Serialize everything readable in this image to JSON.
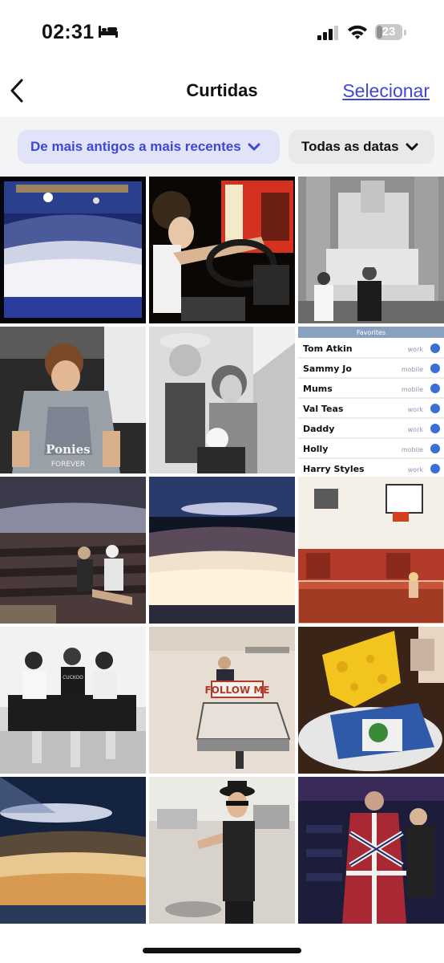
{
  "status": {
    "time": "02:31",
    "battery": "23",
    "battery_level": 0.23
  },
  "nav": {
    "title": "Curtidas",
    "select_label": "Selecionar"
  },
  "filters": {
    "sort_label": "De mais antigos a mais recentes",
    "date_label": "Todas as datas"
  },
  "tiles": [
    {
      "name": "photo-concert-arena"
    },
    {
      "name": "photo-driving-bus"
    },
    {
      "name": "photo-lincoln-memorial"
    },
    {
      "name": "photo-ponies-tshirt"
    },
    {
      "name": "photo-hug-stairs"
    },
    {
      "name": "photo-contacts-screen"
    },
    {
      "name": "photo-stadium-seats"
    },
    {
      "name": "photo-concert-crowd"
    },
    {
      "name": "photo-basketball-court"
    },
    {
      "name": "photo-three-on-sofa"
    },
    {
      "name": "photo-follow-me-sign"
    },
    {
      "name": "photo-cheese-hat"
    },
    {
      "name": "photo-concert-lights"
    },
    {
      "name": "photo-hat-pointing"
    },
    {
      "name": "photo-flag-jacket"
    }
  ],
  "contacts": {
    "header": "Favorites",
    "rows": [
      {
        "name": "Tom Atkin",
        "type": "work"
      },
      {
        "name": "Sammy Jo",
        "type": "mobile"
      },
      {
        "name": "Mums",
        "type": "mobile"
      },
      {
        "name": "Val Teas",
        "type": "work"
      },
      {
        "name": "Daddy",
        "type": "work"
      },
      {
        "name": "Holly",
        "type": "mobile"
      },
      {
        "name": "Harry Styles",
        "type": "work"
      }
    ]
  },
  "sign_texts": {
    "shirt_line1": "Ponies",
    "shirt_line2": "FOREVER",
    "follow_me": "FOLLOW ME",
    "tee": "CUCKOO"
  },
  "colors": {
    "accent": "#3e47d6",
    "chip_bg": "#e1e3f8"
  }
}
